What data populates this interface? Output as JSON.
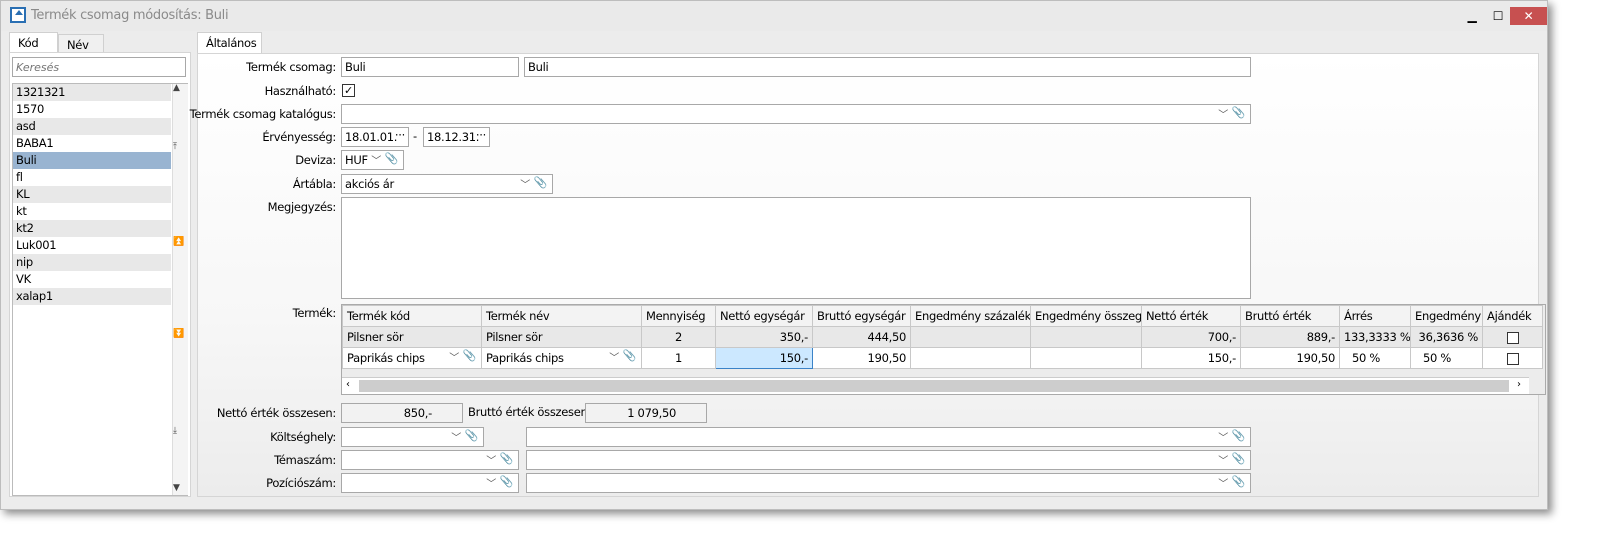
{
  "window": {
    "title": "Termék csomag módosítás: Buli",
    "minimize": "▁",
    "maximize": "☐",
    "close": "✕"
  },
  "left": {
    "tabs": [
      "Kód",
      "Név"
    ],
    "search_placeholder": "Keresés",
    "items": [
      "1321321",
      "1570",
      "asd",
      "BABA1",
      "Buli",
      "fl",
      "KL",
      "kt",
      "kt2",
      "Luk001",
      "nip",
      "VK",
      "xalap1"
    ],
    "selected": "Buli"
  },
  "main": {
    "tab": "Általános",
    "labels": {
      "csomag": "Termék csomag:",
      "hasznalhato": "Használható:",
      "katalogus": "Termék csomag katalógus:",
      "ervenyesseg": "Érvényesség:",
      "deviza": "Deviza:",
      "artabla": "Ártábla:",
      "megjegyzes": "Megjegyzés:",
      "termek": "Termék:",
      "netto_ossz": "Nettó érték összesen:",
      "brutto_ossz": "Bruttó érték összesen:",
      "koltseghely": "Költséghely:",
      "temaszam": "Témaszám:",
      "pozicioszam": "Pozíciószám:"
    },
    "values": {
      "csomag_kod": "Buli",
      "csomag_nev": "Buli",
      "hasznalhato": true,
      "katalogus": "",
      "ervenyes_tol": "18.01.01.",
      "ervenyes_ig": "18.12.31.",
      "dash": "-",
      "deviza": "HUF",
      "artabla": "akciós ár",
      "megjegyzes": "",
      "netto_ossz": "850,-",
      "brutto_ossz": "1 079,50",
      "koltseghely": "",
      "temaszam": "",
      "pozicioszam": ""
    },
    "grid": {
      "columns": [
        "Termék kód",
        "Termék név",
        "Mennyiség",
        "Nettó egységár",
        "Bruttó egységár",
        "Engedmény százalék",
        "Engedmény összeg",
        "Nettó érték",
        "Bruttó érték",
        "Árrés",
        "Engedmény",
        "Ajándék"
      ],
      "rows": [
        [
          "Pilsner sör",
          "Pilsner sör",
          "2",
          "350,-",
          "444,50",
          "",
          "",
          "700,-",
          "889,-",
          "133,3333 %",
          "36,3636 %",
          false
        ],
        [
          "Paprikás chips",
          "Paprikás chips",
          "1",
          "150,-",
          "190,50",
          "",
          "",
          "150,-",
          "190,50",
          "50 %",
          "50 %",
          false
        ]
      ]
    }
  },
  "colors": {
    "selection": "#99b4d1",
    "close": "#c75050",
    "active_cell": "#cce8ff"
  }
}
